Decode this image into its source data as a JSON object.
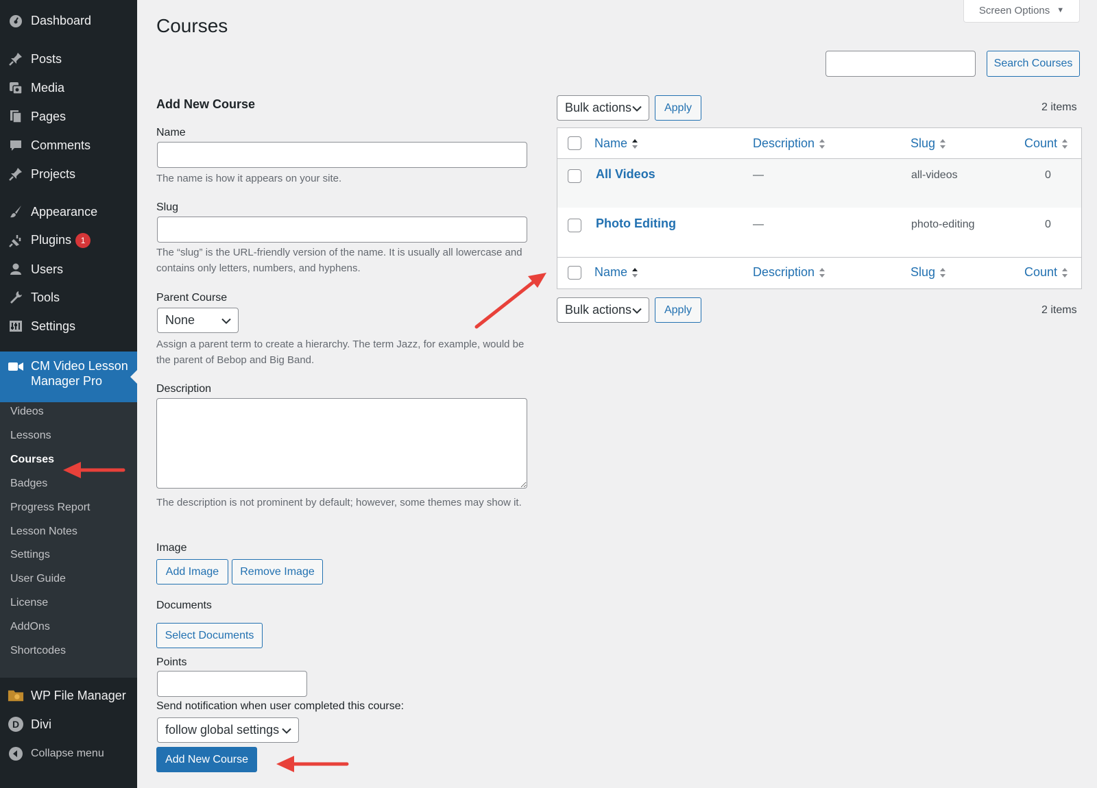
{
  "sidebar": {
    "items": [
      {
        "label": "Dashboard",
        "icon": "dashboard-icon"
      },
      {
        "label": "Posts",
        "icon": "pin-icon"
      },
      {
        "label": "Media",
        "icon": "media-icon"
      },
      {
        "label": "Pages",
        "icon": "pages-icon"
      },
      {
        "label": "Comments",
        "icon": "comment-icon"
      },
      {
        "label": "Projects",
        "icon": "pin-icon"
      },
      {
        "label": "Appearance",
        "icon": "brush-icon"
      },
      {
        "label": "Plugins",
        "icon": "plugin-icon",
        "badge": "1"
      },
      {
        "label": "Users",
        "icon": "user-icon"
      },
      {
        "label": "Tools",
        "icon": "wrench-icon"
      },
      {
        "label": "Settings",
        "icon": "settings-icon"
      }
    ],
    "active": {
      "label": "CM Video Lesson Manager Pro",
      "icon": "video-camera-icon"
    },
    "submenu": [
      "Videos",
      "Lessons",
      "Courses",
      "Badges",
      "Progress Report",
      "Lesson Notes",
      "Settings",
      "User Guide",
      "License",
      "AddOns",
      "Shortcodes"
    ],
    "submenu_current": "Courses",
    "after": [
      {
        "label": "WP File Manager",
        "icon": "folder-icon"
      },
      {
        "label": "Divi",
        "icon": "divi-icon"
      }
    ],
    "collapse": "Collapse menu"
  },
  "header": {
    "title": "Courses",
    "screen_options": "Screen Options",
    "search_button": "Search Courses",
    "search_value": ""
  },
  "form": {
    "heading": "Add New Course",
    "name_label": "Name",
    "name_help": "The name is how it appears on your site.",
    "slug_label": "Slug",
    "slug_help": "The “slug” is the URL-friendly version of the name. It is usually all lowercase and contains only letters, numbers, and hyphens.",
    "parent_label": "Parent Course",
    "parent_value": "None",
    "parent_help": "Assign a parent term to create a hierarchy. The term Jazz, for example, would be the parent of Bebop and Big Band.",
    "description_label": "Description",
    "description_help": "The description is not prominent by default; however, some themes may show it.",
    "image_label": "Image",
    "add_image": "Add Image",
    "remove_image": "Remove Image",
    "documents_label": "Documents",
    "select_documents": "Select Documents",
    "points_label": "Points",
    "notify_label": "Send notification when user completed this course:",
    "notify_value": "follow global settings",
    "submit": "Add New Course"
  },
  "table": {
    "bulk_actions": "Bulk actions",
    "apply": "Apply",
    "items_count": "2 items",
    "columns": [
      "Name",
      "Description",
      "Slug",
      "Count"
    ],
    "rows": [
      {
        "name": "All Videos",
        "description": "—",
        "slug": "all-videos",
        "count": "0"
      },
      {
        "name": "Photo Editing",
        "description": "—",
        "slug": "photo-editing",
        "count": "0"
      }
    ]
  },
  "colors": {
    "accent": "#2271b1",
    "sidebar_bg": "#1d2327",
    "submenu_bg": "#2c3338",
    "annotation_arrow": "#e8413a"
  }
}
